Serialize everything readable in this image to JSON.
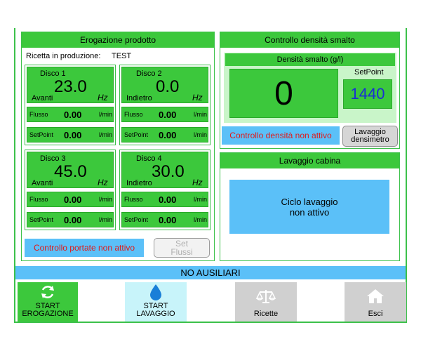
{
  "erogazione": {
    "title": "Erogazione prodotto",
    "ricetta_label": "Ricetta in produzione:",
    "ricetta_value": "TEST",
    "dischi": [
      {
        "name": "Disco 1",
        "value": "23.0",
        "dir": "Avanti",
        "unit": "Hz",
        "flusso_label": "Flusso",
        "flusso_value": "0.00",
        "flusso_unit": "l/min",
        "setpoint_label": "SetPoint",
        "setpoint_value": "0.00",
        "setpoint_unit": "l/min"
      },
      {
        "name": "Disco 2",
        "value": "0.0",
        "dir": "Indietro",
        "unit": "Hz",
        "flusso_label": "Flusso",
        "flusso_value": "0.00",
        "flusso_unit": "l/min",
        "setpoint_label": "SetPoint",
        "setpoint_value": "0.00",
        "setpoint_unit": "l/min"
      },
      {
        "name": "Disco 3",
        "value": "45.0",
        "dir": "Avanti",
        "unit": "Hz",
        "flusso_label": "Flusso",
        "flusso_value": "0.00",
        "flusso_unit": "l/min",
        "setpoint_label": "SetPoint",
        "setpoint_value": "0.00",
        "setpoint_unit": "l/min"
      },
      {
        "name": "Disco 4",
        "value": "30.0",
        "dir": "Indietro",
        "unit": "Hz",
        "flusso_label": "Flusso",
        "flusso_value": "0.00",
        "flusso_unit": "l/min",
        "setpoint_label": "SetPoint",
        "setpoint_value": "0.00",
        "setpoint_unit": "l/min"
      }
    ],
    "status": "Controllo portate non attivo",
    "set_flussi_label": "Set Flussi"
  },
  "densita": {
    "title": "Controllo densità smalto",
    "sub_title": "Densità smalto (g/l)",
    "value": "0",
    "setpoint_label": "SetPoint",
    "setpoint_value": "1440",
    "status": "Controllo densità non attivo",
    "lavaggio_button": "Lavaggio densimetro"
  },
  "cabina": {
    "title": "Lavaggio cabina",
    "status_line1": "Ciclo lavaggio",
    "status_line2": "non attivo"
  },
  "banner": "NO AUSILIARI",
  "bottom": {
    "start_erogazione_1": "START",
    "start_erogazione_2": "EROGAZIONE",
    "start_lavaggio_1": "START",
    "start_lavaggio_2": "LAVAGGIO",
    "ricette": "Ricette",
    "esci": "Esci"
  },
  "colors": {
    "green": "#3cc83c",
    "blue": "#5bc0f8",
    "red": "#e01a1a",
    "setpoint_text": "#1a2fd4"
  }
}
